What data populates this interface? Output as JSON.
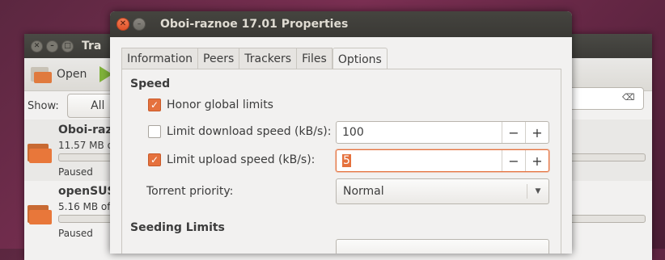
{
  "background_window": {
    "title": "Tra",
    "toolbar": {
      "open_label": "Open"
    },
    "filter": {
      "show_label": "Show:",
      "all_label": "All"
    },
    "torrents": [
      {
        "name": "Oboi-razn",
        "size": "11.57 MB o",
        "status": "Paused",
        "progress": 0
      },
      {
        "name": "openSUS",
        "size": "5.16 MB of",
        "status": "Paused",
        "progress": 0
      }
    ]
  },
  "dialog": {
    "title": "Oboi-raznoe 17.01 Properties",
    "tabs": [
      {
        "label": "Information",
        "active": false
      },
      {
        "label": "Peers",
        "active": false
      },
      {
        "label": "Trackers",
        "active": false
      },
      {
        "label": "Files",
        "active": false
      },
      {
        "label": "Options",
        "active": true
      }
    ],
    "speed": {
      "heading": "Speed",
      "honor_global": {
        "label": "Honor global limits",
        "checked": true
      },
      "limit_download": {
        "label": "Limit download speed (kB/s):",
        "checked": false,
        "value": "100"
      },
      "limit_upload": {
        "label": "Limit upload speed (kB/s):",
        "checked": true,
        "value": "5"
      },
      "priority": {
        "label": "Torrent priority:",
        "value": "Normal"
      }
    },
    "seeding": {
      "heading": "Seeding Limits"
    }
  },
  "colors": {
    "accent": "#e5713d",
    "titlebar": "#3c3b37",
    "window_bg": "#f2f1f0"
  }
}
